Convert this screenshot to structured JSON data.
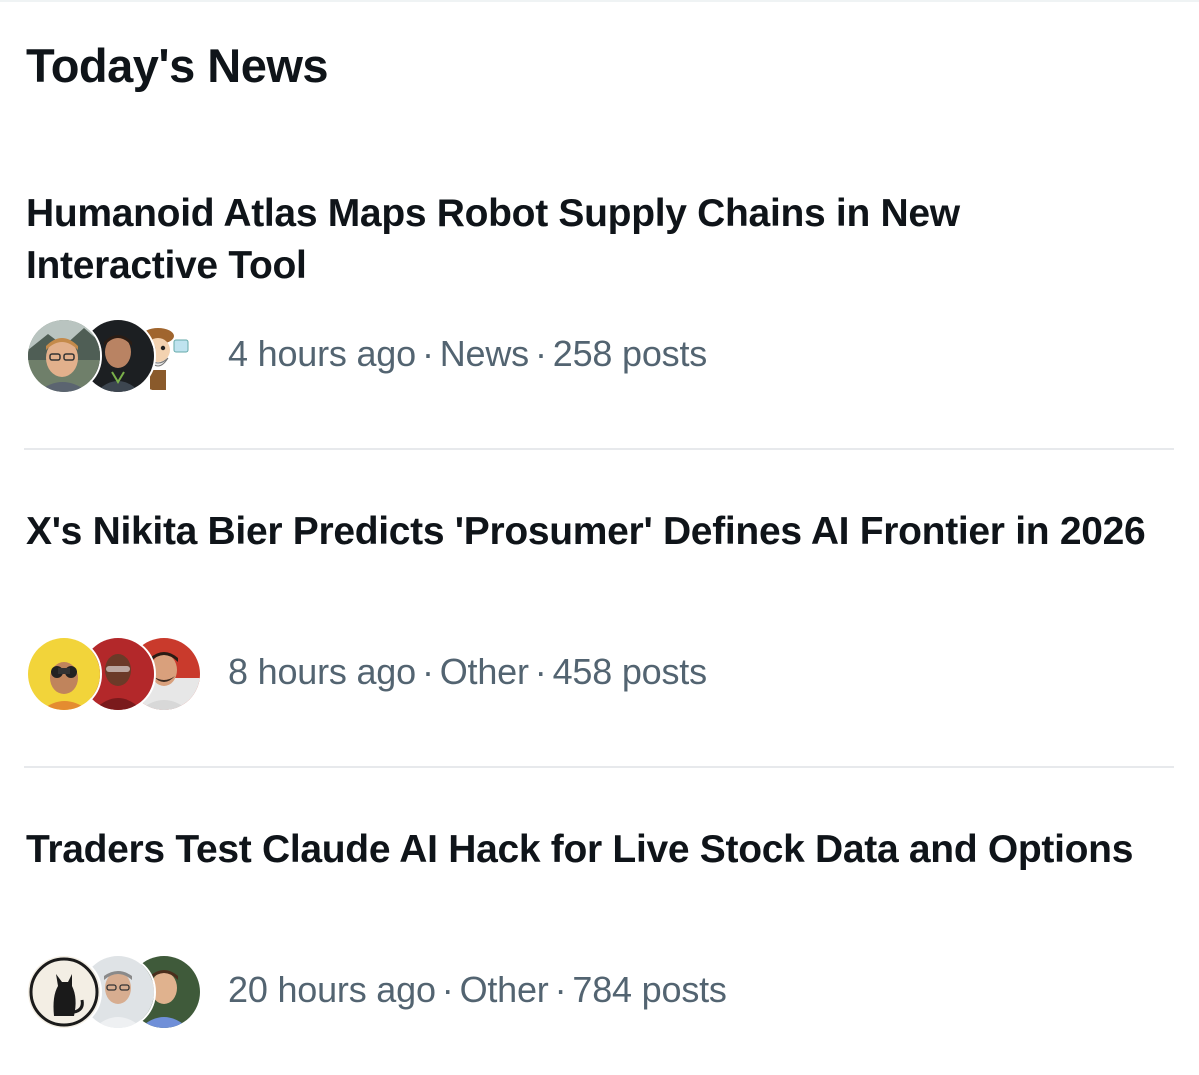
{
  "section": {
    "title": "Today's News"
  },
  "items": [
    {
      "headline": "Humanoid Atlas Maps Robot Supply Chains in New Interactive Tool",
      "time": "4 hours ago",
      "category": "News",
      "posts": "258 posts"
    },
    {
      "headline": "X's Nikita Bier Predicts 'Prosumer' Defines AI Frontier in 2026",
      "time": "8 hours ago",
      "category": "Other",
      "posts": "458 posts"
    },
    {
      "headline": "Traders Test Claude AI Hack for Live Stock Data and Options",
      "time": "20 hours ago",
      "category": "Other",
      "posts": "784 posts"
    }
  ],
  "separator": "·"
}
